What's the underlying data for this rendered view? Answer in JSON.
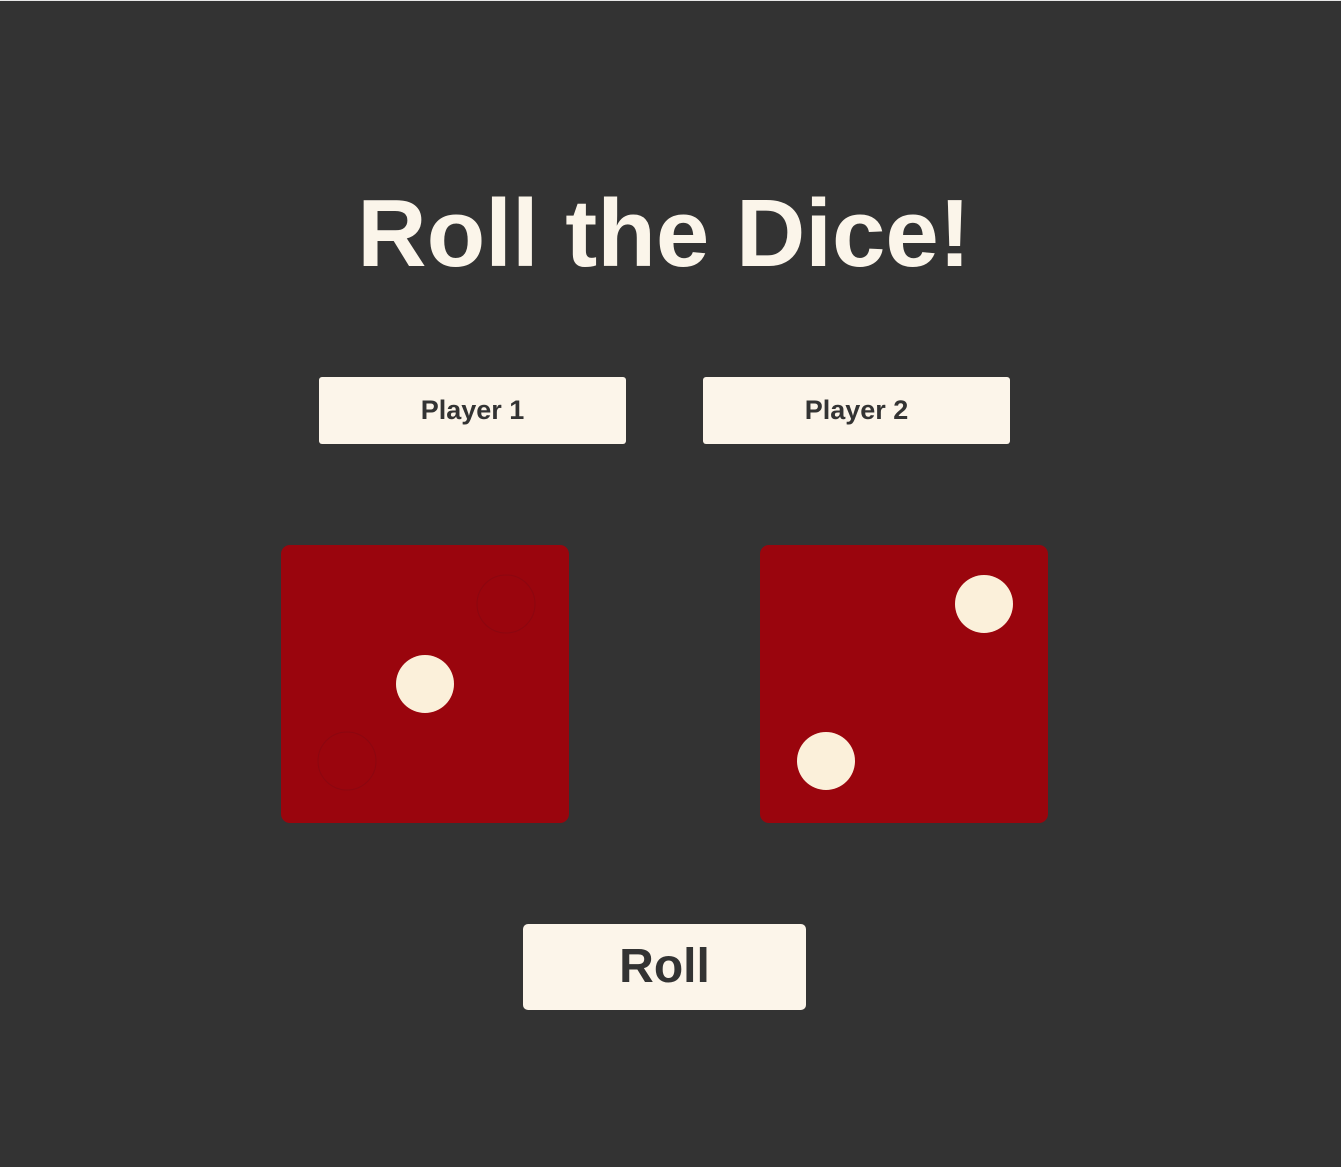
{
  "title": "Roll the Dice!",
  "players": [
    {
      "label": "Player 1"
    },
    {
      "label": "Player 2"
    }
  ],
  "dice": [
    {
      "value": 1
    },
    {
      "value": 2
    }
  ],
  "roll_button": {
    "label": "Roll"
  },
  "colors": {
    "background": "#333333",
    "die": "#9a050d",
    "pip": "#fbf0da",
    "button": "#fcf5ea",
    "text_dark": "#333333",
    "text_light": "#fbf5ea"
  }
}
